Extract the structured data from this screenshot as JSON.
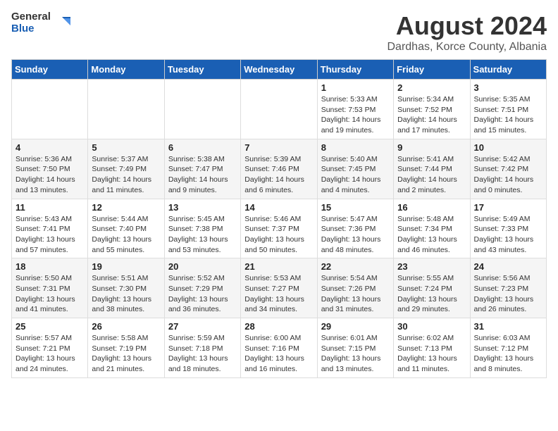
{
  "logo": {
    "general": "General",
    "blue": "Blue"
  },
  "title": "August 2024",
  "subtitle": "Dardhas, Korce County, Albania",
  "days_header": [
    "Sunday",
    "Monday",
    "Tuesday",
    "Wednesday",
    "Thursday",
    "Friday",
    "Saturday"
  ],
  "weeks": [
    [
      {
        "day": "",
        "info": ""
      },
      {
        "day": "",
        "info": ""
      },
      {
        "day": "",
        "info": ""
      },
      {
        "day": "",
        "info": ""
      },
      {
        "day": "1",
        "info": "Sunrise: 5:33 AM\nSunset: 7:53 PM\nDaylight: 14 hours\nand 19 minutes."
      },
      {
        "day": "2",
        "info": "Sunrise: 5:34 AM\nSunset: 7:52 PM\nDaylight: 14 hours\nand 17 minutes."
      },
      {
        "day": "3",
        "info": "Sunrise: 5:35 AM\nSunset: 7:51 PM\nDaylight: 14 hours\nand 15 minutes."
      }
    ],
    [
      {
        "day": "4",
        "info": "Sunrise: 5:36 AM\nSunset: 7:50 PM\nDaylight: 14 hours\nand 13 minutes."
      },
      {
        "day": "5",
        "info": "Sunrise: 5:37 AM\nSunset: 7:49 PM\nDaylight: 14 hours\nand 11 minutes."
      },
      {
        "day": "6",
        "info": "Sunrise: 5:38 AM\nSunset: 7:47 PM\nDaylight: 14 hours\nand 9 minutes."
      },
      {
        "day": "7",
        "info": "Sunrise: 5:39 AM\nSunset: 7:46 PM\nDaylight: 14 hours\nand 6 minutes."
      },
      {
        "day": "8",
        "info": "Sunrise: 5:40 AM\nSunset: 7:45 PM\nDaylight: 14 hours\nand 4 minutes."
      },
      {
        "day": "9",
        "info": "Sunrise: 5:41 AM\nSunset: 7:44 PM\nDaylight: 14 hours\nand 2 minutes."
      },
      {
        "day": "10",
        "info": "Sunrise: 5:42 AM\nSunset: 7:42 PM\nDaylight: 14 hours\nand 0 minutes."
      }
    ],
    [
      {
        "day": "11",
        "info": "Sunrise: 5:43 AM\nSunset: 7:41 PM\nDaylight: 13 hours\nand 57 minutes."
      },
      {
        "day": "12",
        "info": "Sunrise: 5:44 AM\nSunset: 7:40 PM\nDaylight: 13 hours\nand 55 minutes."
      },
      {
        "day": "13",
        "info": "Sunrise: 5:45 AM\nSunset: 7:38 PM\nDaylight: 13 hours\nand 53 minutes."
      },
      {
        "day": "14",
        "info": "Sunrise: 5:46 AM\nSunset: 7:37 PM\nDaylight: 13 hours\nand 50 minutes."
      },
      {
        "day": "15",
        "info": "Sunrise: 5:47 AM\nSunset: 7:36 PM\nDaylight: 13 hours\nand 48 minutes."
      },
      {
        "day": "16",
        "info": "Sunrise: 5:48 AM\nSunset: 7:34 PM\nDaylight: 13 hours\nand 46 minutes."
      },
      {
        "day": "17",
        "info": "Sunrise: 5:49 AM\nSunset: 7:33 PM\nDaylight: 13 hours\nand 43 minutes."
      }
    ],
    [
      {
        "day": "18",
        "info": "Sunrise: 5:50 AM\nSunset: 7:31 PM\nDaylight: 13 hours\nand 41 minutes."
      },
      {
        "day": "19",
        "info": "Sunrise: 5:51 AM\nSunset: 7:30 PM\nDaylight: 13 hours\nand 38 minutes."
      },
      {
        "day": "20",
        "info": "Sunrise: 5:52 AM\nSunset: 7:29 PM\nDaylight: 13 hours\nand 36 minutes."
      },
      {
        "day": "21",
        "info": "Sunrise: 5:53 AM\nSunset: 7:27 PM\nDaylight: 13 hours\nand 34 minutes."
      },
      {
        "day": "22",
        "info": "Sunrise: 5:54 AM\nSunset: 7:26 PM\nDaylight: 13 hours\nand 31 minutes."
      },
      {
        "day": "23",
        "info": "Sunrise: 5:55 AM\nSunset: 7:24 PM\nDaylight: 13 hours\nand 29 minutes."
      },
      {
        "day": "24",
        "info": "Sunrise: 5:56 AM\nSunset: 7:23 PM\nDaylight: 13 hours\nand 26 minutes."
      }
    ],
    [
      {
        "day": "25",
        "info": "Sunrise: 5:57 AM\nSunset: 7:21 PM\nDaylight: 13 hours\nand 24 minutes."
      },
      {
        "day": "26",
        "info": "Sunrise: 5:58 AM\nSunset: 7:19 PM\nDaylight: 13 hours\nand 21 minutes."
      },
      {
        "day": "27",
        "info": "Sunrise: 5:59 AM\nSunset: 7:18 PM\nDaylight: 13 hours\nand 18 minutes."
      },
      {
        "day": "28",
        "info": "Sunrise: 6:00 AM\nSunset: 7:16 PM\nDaylight: 13 hours\nand 16 minutes."
      },
      {
        "day": "29",
        "info": "Sunrise: 6:01 AM\nSunset: 7:15 PM\nDaylight: 13 hours\nand 13 minutes."
      },
      {
        "day": "30",
        "info": "Sunrise: 6:02 AM\nSunset: 7:13 PM\nDaylight: 13 hours\nand 11 minutes."
      },
      {
        "day": "31",
        "info": "Sunrise: 6:03 AM\nSunset: 7:12 PM\nDaylight: 13 hours\nand 8 minutes."
      }
    ]
  ]
}
